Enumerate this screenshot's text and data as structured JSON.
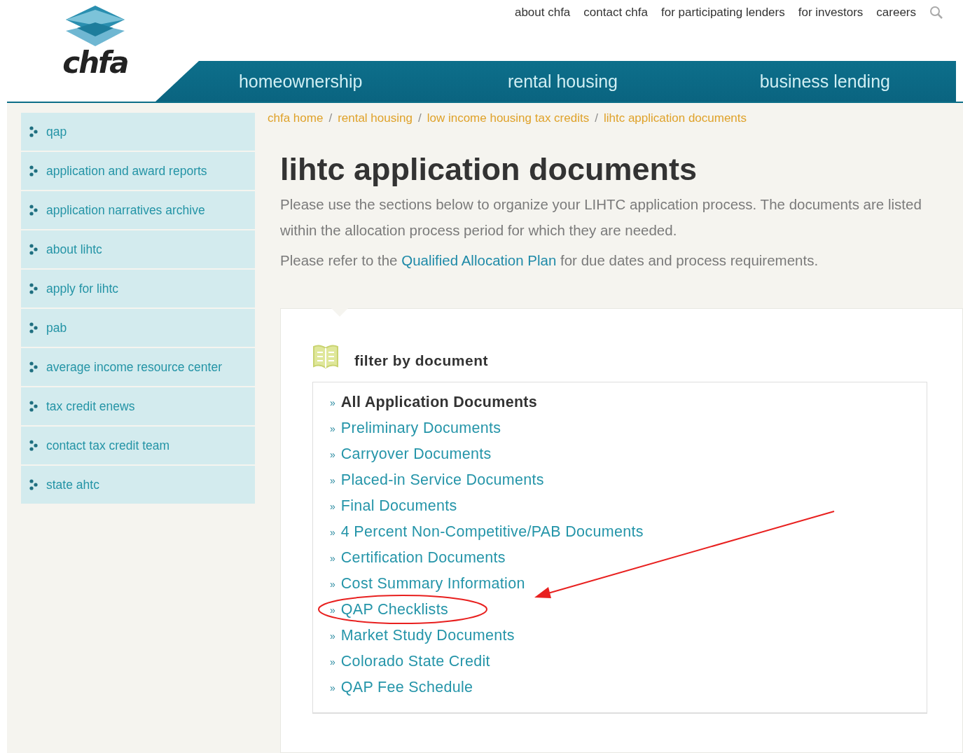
{
  "header": {
    "logo_text": "chfa",
    "top_links": [
      "about chfa",
      "contact chfa",
      "for participating lenders",
      "for investors",
      "careers"
    ]
  },
  "main_nav": [
    "homeownership",
    "rental housing",
    "business lending"
  ],
  "sidebar": {
    "items": [
      "qap",
      "application and award reports",
      "application narratives archive",
      "about lihtc",
      "apply for lihtc",
      "pab",
      "average income resource center",
      "tax credit enews",
      "contact tax credit team",
      "state ahtc"
    ]
  },
  "breadcrumb": [
    {
      "label": "chfa home"
    },
    {
      "separator": "/",
      "label": "rental housing"
    },
    {
      "separator": "/",
      "label": "low income housing tax credits"
    },
    {
      "separator": "/",
      "label": "lihtc application documents"
    }
  ],
  "page_title": "lihtc application documents",
  "intro": [
    "Please use the sections below to organize your LIHTC application process. The documents are listed within the allocation process period for which they are needed."
  ],
  "refer": {
    "before": "Please refer to the",
    "link": "Qualified Allocation Plan",
    "after": "for due dates and process requirements."
  },
  "filter": {
    "heading": "filter by document",
    "items": [
      {
        "bullet": "»",
        "label": "All Application Documents",
        "selected": true,
        "circled": false
      },
      {
        "bullet": "»",
        "label": "Preliminary Documents",
        "selected": false,
        "circled": false
      },
      {
        "bullet": "»",
        "label": "Carryover Documents",
        "selected": false,
        "circled": false
      },
      {
        "bullet": "»",
        "label": "Placed-in Service Documents",
        "selected": false,
        "circled": false
      },
      {
        "bullet": "»",
        "label": "Final Documents",
        "selected": false,
        "circled": false
      },
      {
        "bullet": "»",
        "label": "4 Percent Non-Competitive/PAB Documents",
        "selected": false,
        "circled": false
      },
      {
        "bullet": "»",
        "label": "Certification Documents",
        "selected": false,
        "circled": false
      },
      {
        "bullet": "»",
        "label": "Cost Summary Information",
        "selected": false,
        "circled": false
      },
      {
        "bullet": "»",
        "label": "QAP Checklists",
        "selected": false,
        "circled": true
      },
      {
        "bullet": "»",
        "label": "Market Study Documents",
        "selected": false,
        "circled": false
      },
      {
        "bullet": "»",
        "label": "Colorado State Credit",
        "selected": false,
        "circled": false
      },
      {
        "bullet": "»",
        "label": "QAP Fee Schedule",
        "selected": false,
        "circled": false
      }
    ]
  }
}
